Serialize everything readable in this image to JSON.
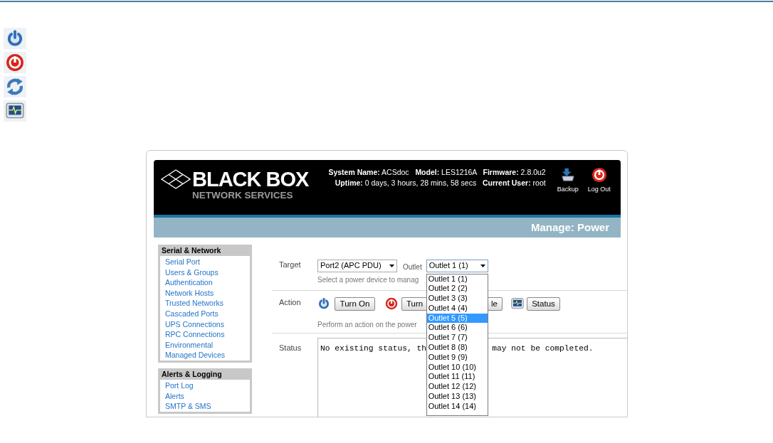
{
  "legend_icons": [
    {
      "kind": "power_on"
    },
    {
      "kind": "power_off"
    },
    {
      "kind": "cycle"
    },
    {
      "kind": "status"
    }
  ],
  "header": {
    "logo_title": "BLACK BOX",
    "logo_subtitle": "NETWORK SERVICES",
    "info_lines": [
      "**System Name:** ACSdoc   **Model:** LES1216A   **Firmware:** 2.8.0u2",
      "**Uptime:** 0 days, 3 hours, 28 mins, 58 secs   **Current User:** root"
    ],
    "buttons": [
      {
        "kind": "backup",
        "label": "Backup"
      },
      {
        "kind": "logout",
        "label": "Log Out"
      }
    ]
  },
  "page_title": "Manage: Power",
  "sidebar": [
    {
      "title": "Serial & Network",
      "items": [
        "Serial Port",
        "Users & Groups",
        "Authentication",
        "Network Hosts",
        "Trusted Networks",
        "Cascaded Ports",
        "UPS Connections",
        "RPC Connections",
        "Environmental",
        "Managed Devices"
      ]
    },
    {
      "title": "Alerts & Logging",
      "items": [
        "Port Log",
        "Alerts",
        "SMTP & SMS"
      ]
    }
  ],
  "target": {
    "label": "Target",
    "device": "Port2 (APC PDU)",
    "outlet_label": "Outlet",
    "outlet": "Outlet 1 (1)",
    "hint": "Select a power device to manag"
  },
  "outlet_options": [
    {
      "label": "Outlet 1 (1)",
      "selected": false
    },
    {
      "label": "Outlet 2 (2)",
      "selected": false
    },
    {
      "label": "Outlet 3 (3)",
      "selected": false
    },
    {
      "label": "Outlet 4 (4)",
      "selected": false
    },
    {
      "label": "Outlet 5 (5)",
      "selected": true
    },
    {
      "label": "Outlet 6 (6)",
      "selected": false
    },
    {
      "label": "Outlet 7 (7)",
      "selected": false
    },
    {
      "label": "Outlet 8 (8)",
      "selected": false
    },
    {
      "label": "Outlet 9 (9)",
      "selected": false
    },
    {
      "label": "Outlet 10 (10)",
      "selected": false
    },
    {
      "label": "Outlet 11 (11)",
      "selected": false
    },
    {
      "label": "Outlet 12 (12)",
      "selected": false
    },
    {
      "label": "Outlet 13 (13)",
      "selected": false
    },
    {
      "label": "Outlet 14 (14)",
      "selected": false
    }
  ],
  "action": {
    "label": "Action",
    "buttons": [
      {
        "kind": "power_on",
        "label": "Turn On"
      },
      {
        "kind": "power_off",
        "label": "Turn"
      },
      {
        "kind": "cycle_cut",
        "label": "le"
      },
      {
        "kind": "status",
        "label": "Status"
      }
    ],
    "hint": "Perform an action on the power"
  },
  "status": {
    "label": "Status",
    "text_parts": [
      "No existing status, th",
      "may not be completed."
    ]
  }
}
